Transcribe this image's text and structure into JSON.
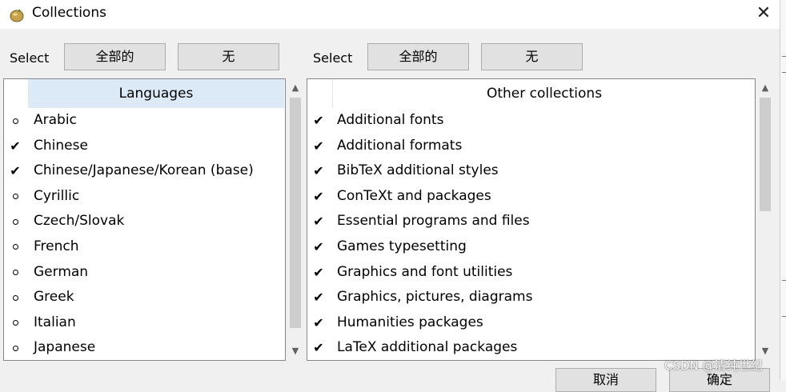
{
  "window": {
    "title": "Collections",
    "close_label": "✕"
  },
  "left": {
    "select_label": "Select",
    "all_button": "全部的",
    "none_button": "无",
    "header": "Languages",
    "items": [
      {
        "label": "Arabic",
        "checked": false
      },
      {
        "label": "Chinese",
        "checked": true
      },
      {
        "label": "Chinese/Japanese/Korean (base)",
        "checked": true
      },
      {
        "label": "Cyrillic",
        "checked": false
      },
      {
        "label": "Czech/Slovak",
        "checked": false
      },
      {
        "label": "French",
        "checked": false
      },
      {
        "label": "German",
        "checked": false
      },
      {
        "label": "Greek",
        "checked": false
      },
      {
        "label": "Italian",
        "checked": false
      },
      {
        "label": "Japanese",
        "checked": false
      }
    ]
  },
  "right": {
    "select_label": "Select",
    "all_button": "全部的",
    "none_button": "无",
    "header": "Other collections",
    "items": [
      {
        "label": "Additional fonts",
        "checked": true
      },
      {
        "label": "Additional formats",
        "checked": true
      },
      {
        "label": "BibTeX additional styles",
        "checked": true
      },
      {
        "label": "ConTeXt and packages",
        "checked": true
      },
      {
        "label": "Essential programs and files",
        "checked": true
      },
      {
        "label": "Games typesetting",
        "checked": true
      },
      {
        "label": "Graphics and font utilities",
        "checked": true
      },
      {
        "label": "Graphics, pictures, diagrams",
        "checked": true
      },
      {
        "label": "Humanities packages",
        "checked": true
      },
      {
        "label": "LaTeX additional packages",
        "checked": true
      }
    ]
  },
  "footer": {
    "cancel_button": "取消",
    "ok_button": "确定"
  },
  "watermark": "CSDN @清纯世纪",
  "colors": {
    "header_highlight": "#dce9f7",
    "accent": "#0078d7"
  }
}
